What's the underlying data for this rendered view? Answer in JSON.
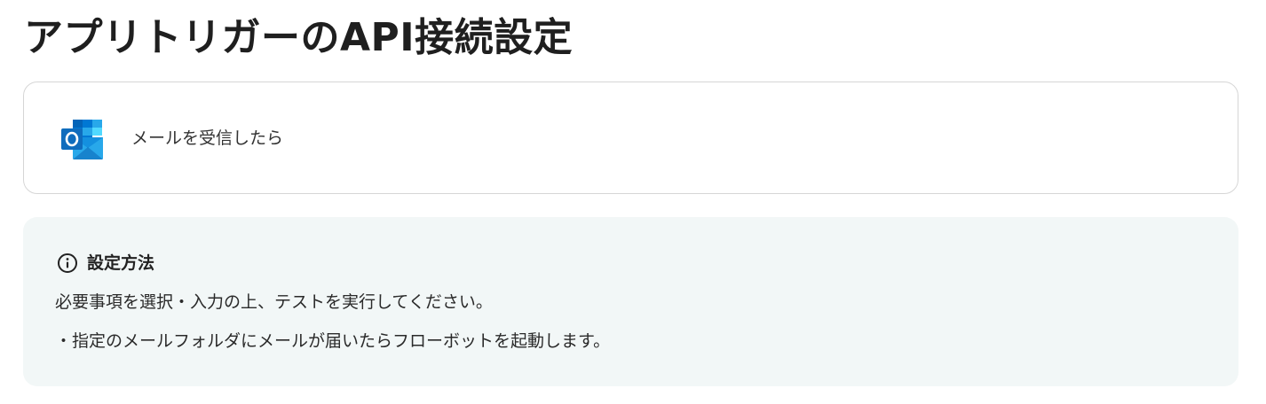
{
  "page": {
    "title": "アプリトリガーのAPI接続設定"
  },
  "trigger": {
    "app_icon": "outlook-icon",
    "label": "メールを受信したら"
  },
  "info": {
    "icon": "info-circle-icon",
    "heading": "設定方法",
    "lines": [
      "必要事項を選択・入力の上、テストを実行してください。",
      "・指定のメールフォルダにメールが届いたらフローボットを起動します。"
    ]
  },
  "colors": {
    "outlook_blue_dark": "#0a64b4",
    "outlook_blue": "#1490df",
    "outlook_blue_light": "#28a8ea",
    "panel_background": "#f2f7f7",
    "card_border": "#d6d6d6"
  }
}
